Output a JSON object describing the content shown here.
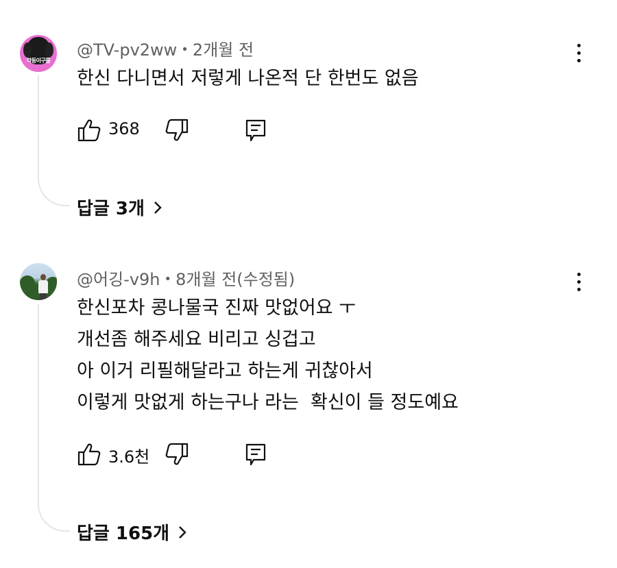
{
  "comments": [
    {
      "author": "@TV-pv2ww",
      "time": "2개월 전",
      "avatar_text": "깍둥이구름",
      "lines": [
        "한신 다니면서 저렇게 나온적 단 한번도 없음"
      ],
      "likes": "368",
      "replies_label": "답글 3개"
    },
    {
      "author": "@어깅-v9h",
      "time": "8개월 전(수정됨)",
      "lines": [
        "한신포차 콩나물국 진짜 맛없어요 ㅜ",
        "개선좀 해주세요 비리고 싱겁고",
        "아 이거 리필해달라고 하는게 귀찮아서",
        "이렇게 맛없게 하는구나 라는  확신이 들 정도예요"
      ],
      "likes": "3.6천",
      "replies_label": "답글 165개"
    }
  ],
  "icons": {
    "like": "thumbs-up-icon",
    "dislike": "thumbs-down-icon",
    "reply": "reply-icon",
    "more": "more-vertical-icon",
    "chevron": "chevron-right-icon"
  },
  "colors": {
    "text": "#0f0f0f",
    "meta": "#606060",
    "thread_line": "#e5e5e5",
    "avatar_1_bg": "#e86fd0"
  }
}
